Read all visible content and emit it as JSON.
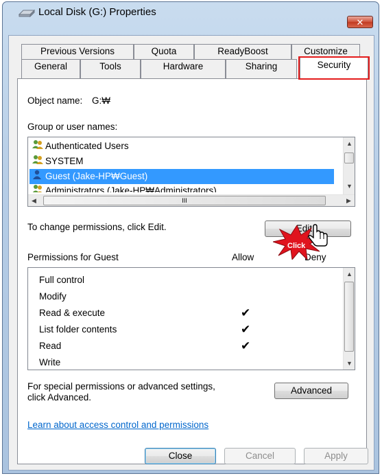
{
  "window": {
    "title": "Local Disk (G:) Properties",
    "close_symbol": "✕"
  },
  "tabs": {
    "row1": [
      "Previous Versions",
      "Quota",
      "ReadyBoost",
      "Customize"
    ],
    "row2": [
      "General",
      "Tools",
      "Hardware",
      "Sharing",
      "Security"
    ],
    "selected": "Security"
  },
  "object": {
    "label": "Object name:",
    "value": "G:₩"
  },
  "groups": {
    "label": "Group or user names:",
    "items": [
      {
        "name": "Authenticated Users",
        "icon": "users-group-icon"
      },
      {
        "name": "SYSTEM",
        "icon": "users-group-icon"
      },
      {
        "name": "Guest (Jake-HP₩Guest)",
        "icon": "user-icon",
        "selected": true
      },
      {
        "name": "Administrators (Jake-HP₩Administrators)",
        "icon": "users-group-icon"
      }
    ],
    "hscroll_mid": "III"
  },
  "change_text": "To change permissions, click Edit.",
  "edit_button": "Edit...",
  "permissions": {
    "header": "Permissions for Guest",
    "allow_label": "Allow",
    "deny_label": "Deny",
    "rows": [
      {
        "name": "Full control",
        "allow": false
      },
      {
        "name": "Modify",
        "allow": false
      },
      {
        "name": "Read & execute",
        "allow": true
      },
      {
        "name": "List folder contents",
        "allow": true
      },
      {
        "name": "Read",
        "allow": true
      },
      {
        "name": "Write",
        "allow": false
      }
    ],
    "check_symbol": "✔"
  },
  "special": {
    "text_line1": "For special permissions or advanced settings,",
    "text_line2": "click Advanced.",
    "button": "Advanced"
  },
  "link": "Learn about access control and permissions",
  "buttons": {
    "close": "Close",
    "cancel": "Cancel",
    "apply": "Apply"
  },
  "annotation": {
    "click_label": "Click"
  },
  "colors": {
    "selection": "#3399ff",
    "highlight_box": "#e41b1b",
    "link": "#0066cc",
    "burst": "#e0141e"
  }
}
